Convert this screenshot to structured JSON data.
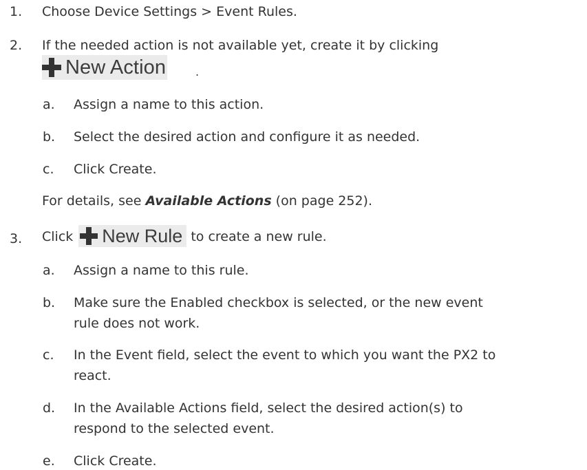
{
  "step1": {
    "number": "1.",
    "text": "Choose Device Settings > Event Rules."
  },
  "step2": {
    "number": "2.",
    "text": "If the needed action is not available yet, create it by clicking",
    "button_label": "New Action",
    "trailing": ".",
    "substeps": [
      {
        "letter": "a.",
        "text": "Assign a name to this action."
      },
      {
        "letter": "b.",
        "text": "Select the desired action and configure it as needed."
      },
      {
        "letter": "c.",
        "text": "Click Create."
      }
    ],
    "details_prefix": "For details, see ",
    "details_link": "Available Actions",
    "details_suffix": " (on page 252)."
  },
  "step3": {
    "number": "3.",
    "prefix": "Click",
    "button_label": "New Rule",
    "suffix": "to create a new rule.",
    "substeps": [
      {
        "letter": "a.",
        "lines": [
          "Assign a name to this rule."
        ]
      },
      {
        "letter": "b.",
        "lines": [
          "Make sure the Enabled checkbox is selected, or the new event",
          "rule does not work."
        ]
      },
      {
        "letter": "c.",
        "lines": [
          "In the Event field, select the event to which you want the PX2 to",
          "react."
        ]
      },
      {
        "letter": "d.",
        "lines": [
          "In the Available Actions field, select the desired action(s) to",
          "respond to the selected event."
        ]
      },
      {
        "letter": "e.",
        "lines": [
          "Click Create."
        ]
      }
    ]
  }
}
